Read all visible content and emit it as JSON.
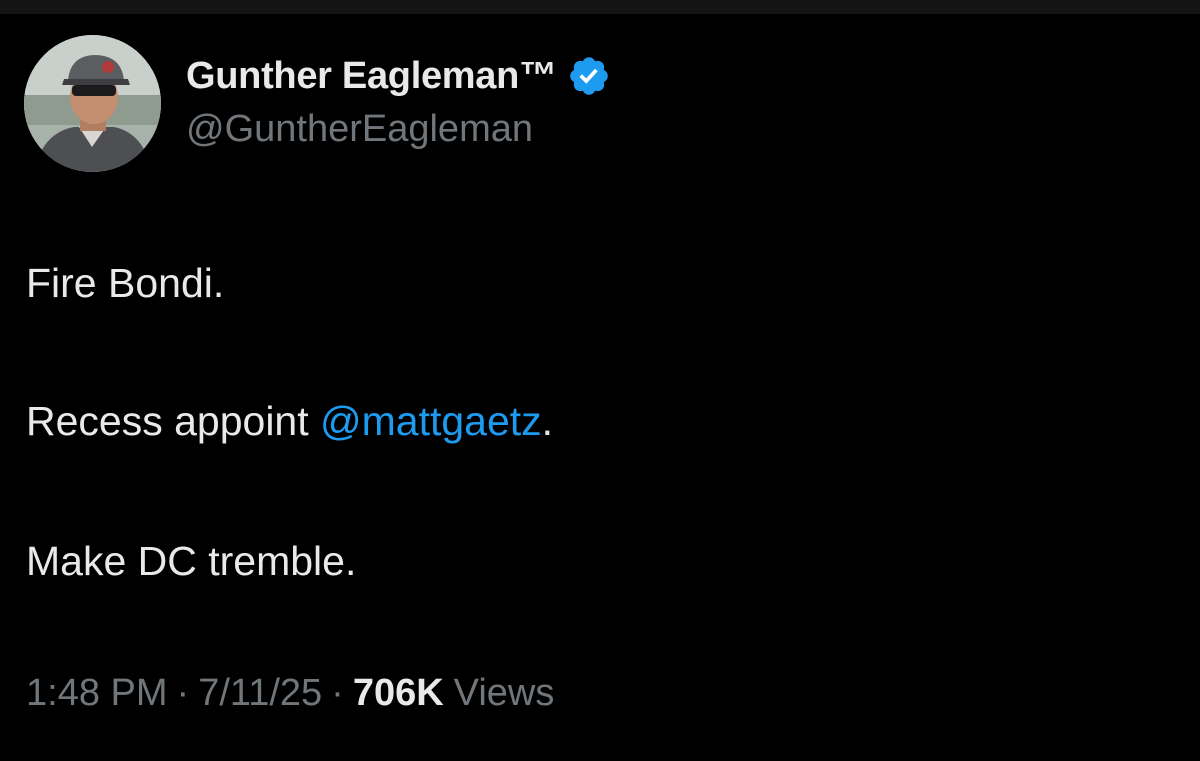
{
  "profile": {
    "display_name": "Gunther Eagleman™",
    "handle": "@GuntherEagleman",
    "avatar_icon": "profile-photo",
    "verified_icon": "verified-badge-icon",
    "verified_color": "#1d9bf0"
  },
  "tweet": {
    "line1": "Fire Bondi.",
    "line2_prefix": "Recess appoint ",
    "line2_mention": "@mattgaetz",
    "line2_suffix": ".",
    "line3": "Make DC tremble."
  },
  "meta": {
    "time": "1:48 PM",
    "separator": "·",
    "date": "7/11/25",
    "views_count": "706K",
    "views_label": "Views"
  },
  "colors": {
    "background": "#000000",
    "text": "#e7e9ea",
    "secondary": "#71767b",
    "link": "#1d9bf0"
  }
}
